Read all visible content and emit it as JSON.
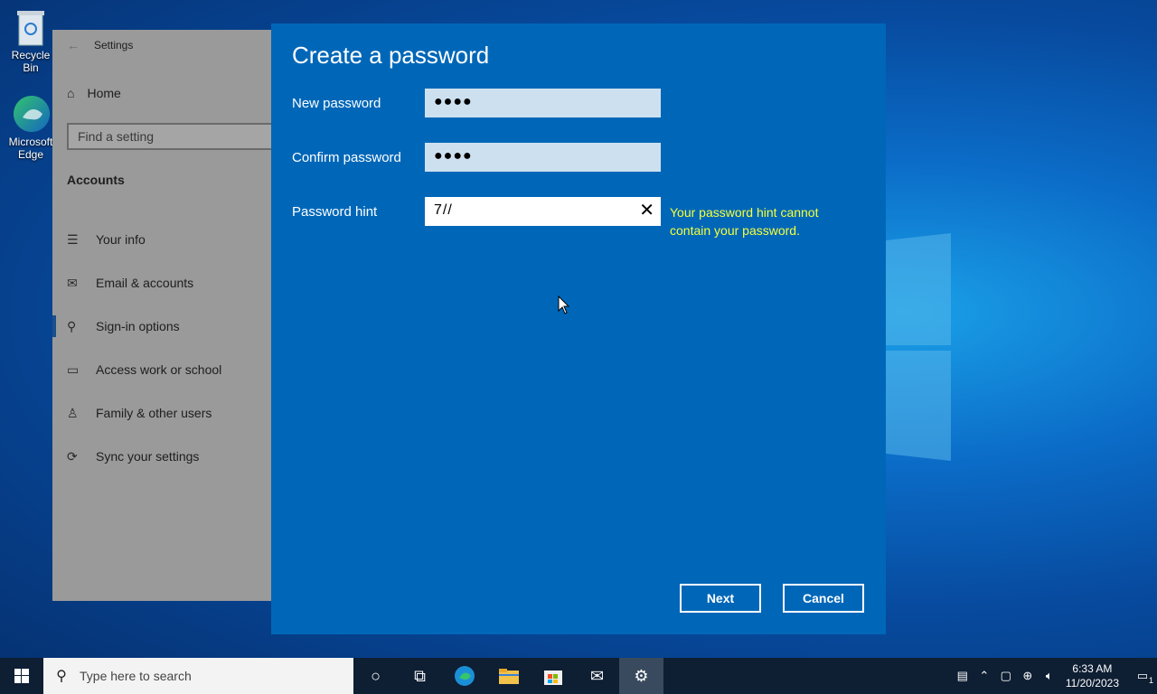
{
  "desktop": {
    "icons": [
      {
        "label": "Recycle Bin",
        "icon": "recycle-bin-icon"
      },
      {
        "label": "Microsoft Edge",
        "icon": "edge-icon"
      }
    ]
  },
  "settings": {
    "title": "Settings",
    "home_label": "Home",
    "search_placeholder": "Find a setting",
    "section_title": "Accounts",
    "nav": [
      {
        "label": "Your info",
        "icon": "person-card-icon"
      },
      {
        "label": "Email & accounts",
        "icon": "mail-icon"
      },
      {
        "label": "Sign-in options",
        "icon": "key-icon",
        "selected": true
      },
      {
        "label": "Access work or school",
        "icon": "briefcase-icon"
      },
      {
        "label": "Family & other users",
        "icon": "person-add-icon"
      },
      {
        "label": "Sync your settings",
        "icon": "sync-icon"
      }
    ]
  },
  "dialog": {
    "title": "Create a password",
    "new_password_label": "New password",
    "new_password_value": "●●●●",
    "confirm_password_label": "Confirm password",
    "confirm_password_value": "●●●●",
    "hint_label": "Password hint",
    "hint_value": "7//",
    "hint_error": "Your password hint cannot contain your password.",
    "next_label": "Next",
    "cancel_label": "Cancel",
    "accent_color": "#0067b8",
    "error_color": "#f7ff3a"
  },
  "taskbar": {
    "search_placeholder": "Type here to search",
    "apps": [
      "cortana-icon",
      "task-view-icon",
      "edge-icon",
      "file-explorer-icon",
      "store-icon",
      "mail-icon",
      "settings-icon"
    ],
    "time": "6:33 AM",
    "date": "11/20/2023",
    "notification_count": "1"
  }
}
